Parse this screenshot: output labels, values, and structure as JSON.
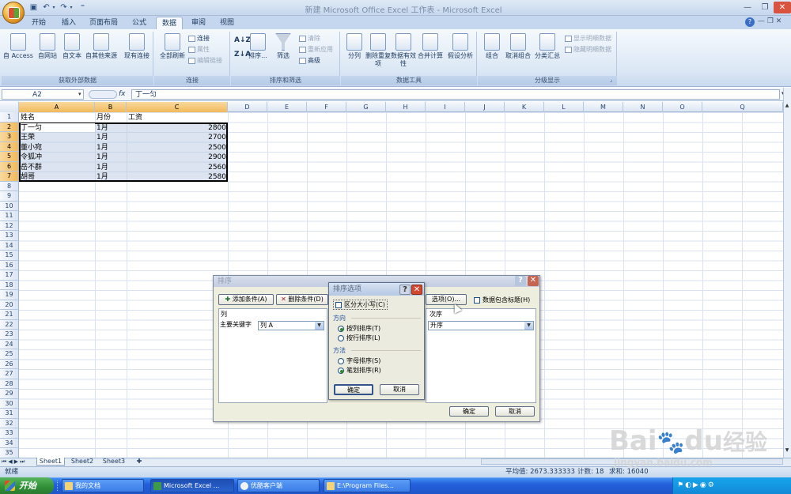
{
  "window": {
    "title": "新建 Microsoft Office Excel 工作表 - Microsoft Excel"
  },
  "tabs": [
    "开始",
    "插入",
    "页面布局",
    "公式",
    "数据",
    "审阅",
    "视图"
  ],
  "ribbon": {
    "external": {
      "label": "获取外部数据",
      "buttons": [
        "自 Access",
        "自网站",
        "自文本",
        "自其他来源",
        "现有连接"
      ]
    },
    "connections": {
      "label": "连接",
      "refresh": "全部刷新",
      "items": [
        "连接",
        "属性",
        "编辑链接"
      ]
    },
    "sort": {
      "label": "排序和筛选",
      "sort": "排序...",
      "filter": "筛选",
      "items": [
        "清除",
        "重新应用",
        "高级"
      ]
    },
    "tools": {
      "label": "数据工具",
      "buttons": [
        "分列",
        "删除重复项",
        "数据有效性",
        "合并计算",
        "假设分析"
      ]
    },
    "outline": {
      "label": "分级显示",
      "buttons": [
        "组合",
        "取消组合",
        "分类汇总"
      ],
      "items": [
        "显示明细数据",
        "隐藏明细数据"
      ]
    }
  },
  "formula_bar": {
    "name_box": "A2",
    "fx": "fx",
    "content": "丁一匀"
  },
  "columns": [
    "A",
    "B",
    "C",
    "D",
    "E",
    "F",
    "G",
    "H",
    "I",
    "J",
    "K",
    "L",
    "M",
    "N",
    "O",
    "Q"
  ],
  "rows": [
    "1",
    "2",
    "3",
    "4",
    "5",
    "6",
    "7",
    "8",
    "9",
    "10",
    "11",
    "12",
    "13",
    "14",
    "15",
    "16",
    "17",
    "18",
    "19",
    "20",
    "21",
    "22",
    "23",
    "24",
    "25",
    "26",
    "27",
    "28",
    "29",
    "30",
    "31",
    "32",
    "33",
    "34",
    "35"
  ],
  "table": {
    "headers": [
      "姓名",
      "月份",
      "工资"
    ],
    "rows": [
      [
        "丁一匀",
        "1月",
        "2800"
      ],
      [
        "王荣",
        "1月",
        "2700"
      ],
      [
        "董小宛",
        "1月",
        "2500"
      ],
      [
        "令狐冲",
        "1月",
        "2900"
      ],
      [
        "岳不群",
        "1月",
        "2560"
      ],
      [
        "胡哥",
        "1月",
        "2580"
      ]
    ]
  },
  "sort_dialog": {
    "title": "排序",
    "add_level": "添加条件(A)",
    "delete_level": "删除条件(D)",
    "options": "选项(O)...",
    "header_checkbox": "数据包含标题(H)",
    "col_header": "列",
    "order_header": "次序",
    "primary_key": "主要关键字",
    "column_value": "列 A",
    "order_value": "升序",
    "ok": "确定",
    "cancel": "取消"
  },
  "options_dialog": {
    "title": "排序选项",
    "case_sensitive": "区分大小写(C)",
    "orientation_label": "方向",
    "by_column": "按列排序(T)",
    "by_row": "按行排序(L)",
    "method_label": "方法",
    "alphabetic": "字母排序(S)",
    "stroke": "笔划排序(R)",
    "ok": "确定",
    "cancel": "取消"
  },
  "sheets": [
    "Sheet1",
    "Sheet2",
    "Sheet3"
  ],
  "status": {
    "ready": "就绪",
    "average": "平均值: 2673.333333",
    "count": "计数: 18",
    "sum": "求和: 16040"
  },
  "taskbar": {
    "start": "开始",
    "items": [
      "我的文档",
      "Microsoft Excel ...",
      "优酷客户端",
      "E:\\Program Files..."
    ]
  },
  "watermark": {
    "brand": "Bai",
    "suffix": "du",
    "cn": "经验",
    "url": "jingyan.baidu.com"
  }
}
